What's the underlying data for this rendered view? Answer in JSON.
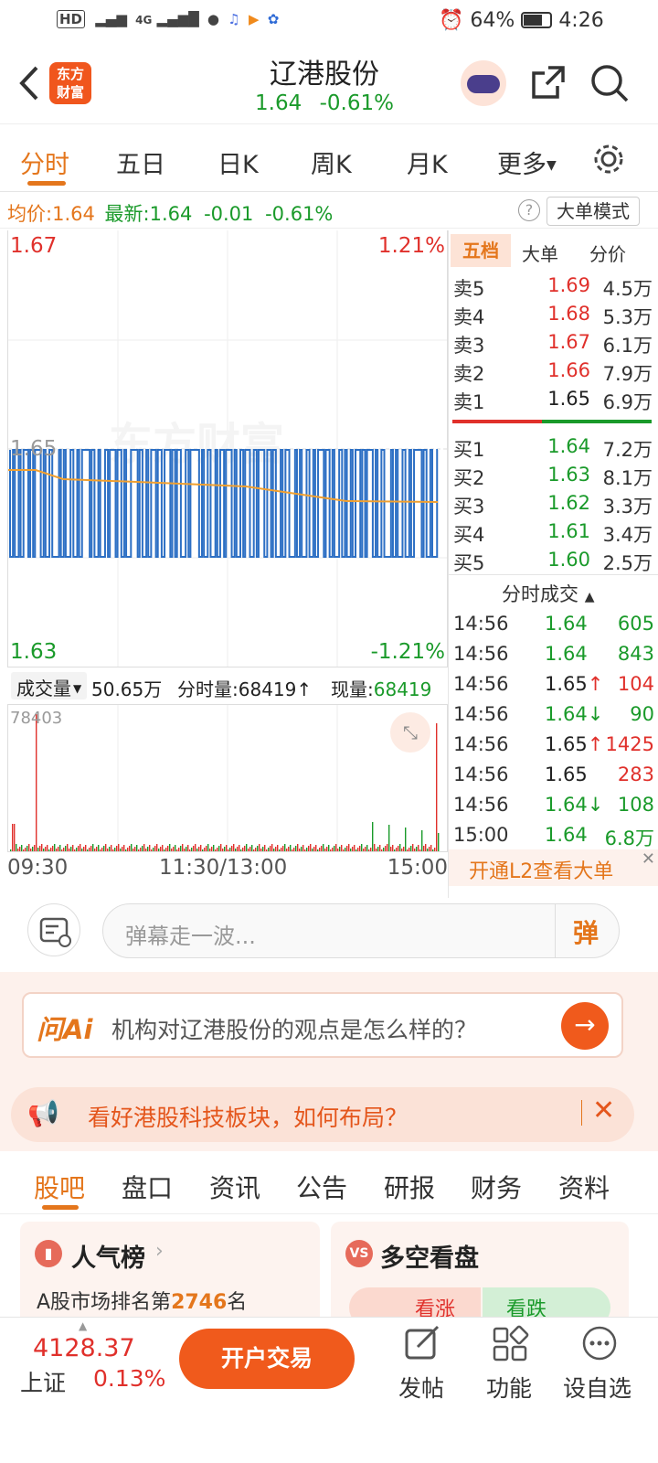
{
  "status_bar": {
    "left_icons": [
      "HD",
      "signal-x",
      "4G",
      "wechat",
      "music",
      "video",
      "baidu"
    ],
    "alarm": "alarm-icon",
    "battery": "64%",
    "time": "4:26"
  },
  "header": {
    "logo_line1": "东方",
    "logo_line2": "财富",
    "stock_name": "辽港股份",
    "price": "1.64",
    "change_pct": "-0.61%"
  },
  "chart_tabs": [
    "分时",
    "五日",
    "日K",
    "周K",
    "月K",
    "更多"
  ],
  "info_line": {
    "avg_label": "均价:",
    "avg_value": "1.64",
    "latest_label": "最新:",
    "latest_value": "1.64",
    "change": "-0.01",
    "change_pct": "-0.61%",
    "mode_button": "大单模式"
  },
  "chart": {
    "top_price": "1.67",
    "top_pct": "1.21%",
    "mid_price": "1.65",
    "bottom_price": "1.63",
    "bottom_pct": "-1.21%",
    "watermark": "东方财富"
  },
  "volume_bar": {
    "selector": "成交量",
    "total": "50.65万",
    "minute_label": "分时量:",
    "minute_value": "68419",
    "current_label": "现量:",
    "current_value": "68419",
    "max": "78403"
  },
  "time_axis": [
    "09:30",
    "11:30/13:00",
    "15:00"
  ],
  "order_book": {
    "tabs": [
      "五档",
      "大单",
      "分价"
    ],
    "asks": [
      {
        "label": "卖5",
        "price": "1.69",
        "vol": "4.5万"
      },
      {
        "label": "卖4",
        "price": "1.68",
        "vol": "5.3万"
      },
      {
        "label": "卖3",
        "price": "1.67",
        "vol": "6.1万"
      },
      {
        "label": "卖2",
        "price": "1.66",
        "vol": "7.9万"
      },
      {
        "label": "卖1",
        "price": "1.65",
        "vol": "6.9万"
      }
    ],
    "bids": [
      {
        "label": "买1",
        "price": "1.64",
        "vol": "7.2万"
      },
      {
        "label": "买2",
        "price": "1.63",
        "vol": "8.1万"
      },
      {
        "label": "买3",
        "price": "1.62",
        "vol": "3.3万"
      },
      {
        "label": "买4",
        "price": "1.61",
        "vol": "3.4万"
      },
      {
        "label": "买5",
        "price": "1.60",
        "vol": "2.5万"
      }
    ]
  },
  "trades": {
    "title": "分时成交",
    "rows": [
      {
        "time": "14:56",
        "price": "1.64",
        "arrow": "",
        "vol": "605",
        "pc": "green",
        "vc": "green"
      },
      {
        "time": "14:56",
        "price": "1.64",
        "arrow": "",
        "vol": "843",
        "pc": "green",
        "vc": "green"
      },
      {
        "time": "14:56",
        "price": "1.65",
        "arrow": "↑",
        "vol": "104",
        "pc": "dark",
        "vc": "red"
      },
      {
        "time": "14:56",
        "price": "1.64",
        "arrow": "↓",
        "vol": "90",
        "pc": "green",
        "vc": "green"
      },
      {
        "time": "14:56",
        "price": "1.65",
        "arrow": "↑",
        "vol": "1425",
        "pc": "dark",
        "vc": "red"
      },
      {
        "time": "14:56",
        "price": "1.65",
        "arrow": "",
        "vol": "283",
        "pc": "dark",
        "vc": "red"
      },
      {
        "time": "14:56",
        "price": "1.64",
        "arrow": "↓",
        "vol": "108",
        "pc": "green",
        "vc": "green"
      },
      {
        "time": "15:00",
        "price": "1.64",
        "arrow": "",
        "vol": "6.8万",
        "pc": "green",
        "vc": "green"
      }
    ],
    "l2_banner": "开通L2查看大单"
  },
  "danmu": {
    "placeholder": "弹幕走一波...",
    "button": "弹"
  },
  "ai": {
    "brand": "问Ai",
    "question": "机构对辽港股份的观点是怎么样的？"
  },
  "promo": {
    "text": "看好港股科技板块，如何布局？"
  },
  "section_tabs": [
    "股吧",
    "盘口",
    "资讯",
    "公告",
    "研报",
    "财务",
    "资料"
  ],
  "cards": {
    "popular_title": "人气榜",
    "popular_sub_prefix": "A股市场排名第",
    "popular_rank": "2746",
    "popular_sub_suffix": "名",
    "vs_title": "多空看盘",
    "bull": "看涨",
    "bear": "看跌"
  },
  "bottom": {
    "index_value": "4128.37",
    "index_name": "上证",
    "index_pct": "0.13%",
    "trade_button": "开户交易",
    "actions": [
      {
        "label": "发帖",
        "icon": "edit-icon"
      },
      {
        "label": "功能",
        "icon": "grid-icon"
      },
      {
        "label": "设自选",
        "icon": "more-icon"
      }
    ]
  }
}
